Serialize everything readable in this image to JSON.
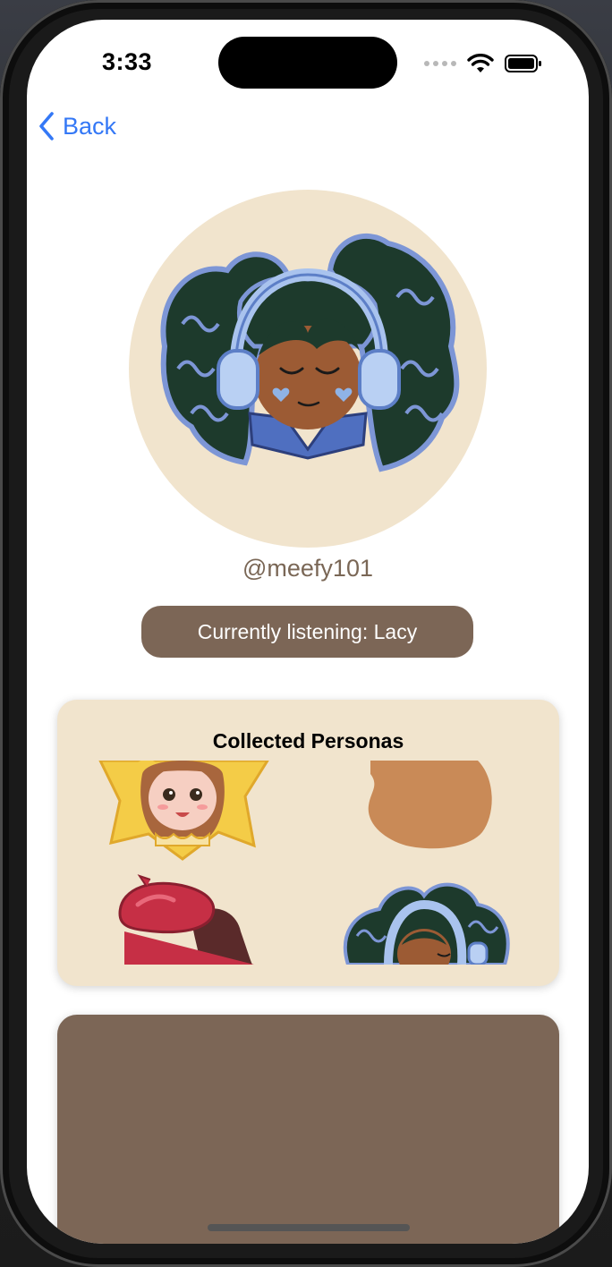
{
  "status_bar": {
    "time": "3:33"
  },
  "nav": {
    "back_label": "Back"
  },
  "profile": {
    "username": "@meefy101",
    "currently_listening": "Currently listening: Lacy"
  },
  "personas": {
    "title": "Collected Personas",
    "items": [
      {
        "icon": "blonde-girl-star-icon"
      },
      {
        "icon": "brown-hair-persona-icon"
      },
      {
        "icon": "red-beret-persona-icon"
      },
      {
        "icon": "curly-hair-headphones-persona-icon"
      }
    ]
  },
  "colors": {
    "accent_brown": "#7c6656",
    "cream": "#f1e4cd",
    "ios_blue": "#3478f6"
  }
}
